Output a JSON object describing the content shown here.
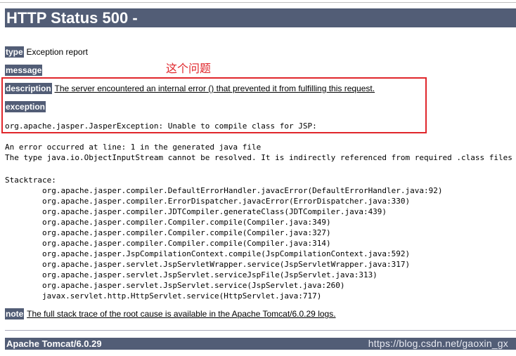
{
  "page": {
    "title": "HTTP Status 500 -",
    "annotation": "这个问题",
    "watermark": "https://blog.csdn.net/gaoxin_gx"
  },
  "type": {
    "label": "type",
    "value": "Exception report"
  },
  "message": {
    "label": "message",
    "value": ""
  },
  "description": {
    "label": "description",
    "value": "The server encountered an internal error () that prevented it from fulfilling this request."
  },
  "exception": {
    "label": "exception",
    "value": "org.apache.jasper.JasperException: Unable to compile class for JSP:"
  },
  "error_lines": [
    "An error occurred at line: 1 in the generated java file",
    "The type java.io.ObjectInputStream cannot be resolved. It is indirectly referenced from required .class files"
  ],
  "stacktrace": {
    "label": "Stacktrace:",
    "frames": [
      "org.apache.jasper.compiler.DefaultErrorHandler.javacError(DefaultErrorHandler.java:92)",
      "org.apache.jasper.compiler.ErrorDispatcher.javacError(ErrorDispatcher.java:330)",
      "org.apache.jasper.compiler.JDTCompiler.generateClass(JDTCompiler.java:439)",
      "org.apache.jasper.compiler.Compiler.compile(Compiler.java:349)",
      "org.apache.jasper.compiler.Compiler.compile(Compiler.java:327)",
      "org.apache.jasper.compiler.Compiler.compile(Compiler.java:314)",
      "org.apache.jasper.JspCompilationContext.compile(JspCompilationContext.java:592)",
      "org.apache.jasper.servlet.JspServletWrapper.service(JspServletWrapper.java:317)",
      "org.apache.jasper.servlet.JspServlet.serviceJspFile(JspServlet.java:313)",
      "org.apache.jasper.servlet.JspServlet.service(JspServlet.java:260)",
      "javax.servlet.http.HttpServlet.service(HttpServlet.java:717)"
    ]
  },
  "note": {
    "label": "note",
    "value": "The full stack trace of the root cause is available in the Apache Tomcat/6.0.29 logs."
  },
  "footer": {
    "server": "Apache Tomcat/6.0.29"
  }
}
